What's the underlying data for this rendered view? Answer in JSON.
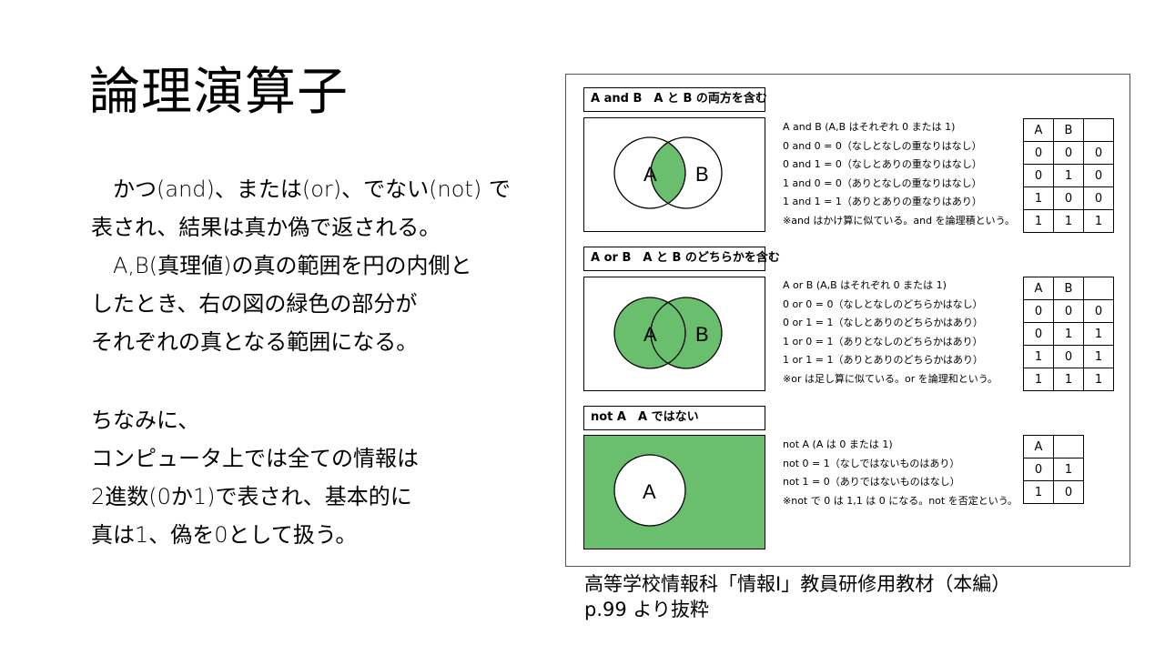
{
  "slide": {
    "title": "論理演算子",
    "paragraph1": [
      "　かつ(and)、または(or)、でない(not) で",
      "表され、結果は真か偽で返される。",
      "　A,B(真理値)の真の範囲を円の内側と",
      "したとき、右の図の緑色の部分が",
      "それぞれの真となる範囲になる。"
    ],
    "paragraph2": [
      "ちなみに、",
      "コンピュータ上では全ての情報は",
      "2進数(0か1)で表され、基本的に",
      "真は1、偽を0として扱う。"
    ],
    "caption": [
      "高等学校情報科「情報Ⅰ」教員研修用教材（本編）",
      "p.99 より抜粋"
    ]
  },
  "colors": {
    "green": "#6abf6e",
    "border": "#000000"
  },
  "figure": {
    "and": {
      "header": "A and B　A と B の両方を含む",
      "circle_a": "A",
      "circle_b": "B",
      "lines": [
        "A and B (A,B はそれぞれ 0 または 1)",
        "0 and 0 = 0（なしとなしの重なりはなし）",
        "0 and 1 = 0（なしとありの重なりはなし）",
        "1 and 0 = 0（ありとなしの重なりはなし）",
        "1 and 1 = 1（ありとありの重なりはあり）",
        "※and はかけ算に似ている。and を論理積という。"
      ],
      "table": [
        [
          "A",
          "B",
          ""
        ],
        [
          "0",
          "0",
          "0"
        ],
        [
          "0",
          "1",
          "0"
        ],
        [
          "1",
          "0",
          "0"
        ],
        [
          "1",
          "1",
          "1"
        ]
      ]
    },
    "or": {
      "header": "A or B　A と B のどちらかを含む",
      "circle_a": "A",
      "circle_b": "B",
      "lines": [
        "A or B (A,B はそれぞれ 0 または 1)",
        "0 or 0 = 0（なしとなしのどちらかはなし）",
        "0 or 1 = 1（なしとありのどちらかはあり）",
        "1 or 0 = 1（ありとなしのどちらかはあり）",
        "1 or 1 = 1（ありとありのどちらかはあり）",
        "※or は足し算に似ている。or を論理和という。"
      ],
      "table": [
        [
          "A",
          "B",
          ""
        ],
        [
          "0",
          "0",
          "0"
        ],
        [
          "0",
          "1",
          "1"
        ],
        [
          "1",
          "0",
          "1"
        ],
        [
          "1",
          "1",
          "1"
        ]
      ]
    },
    "not": {
      "header": "not A　A ではない",
      "circle_a": "A",
      "lines": [
        "not A (A は 0 または 1)",
        "not 0 = 1（なしではないものはあり）",
        "not 1 = 0（ありではないものはなし）",
        "※not で 0 は 1,1 は 0 になる。not を否定という。"
      ],
      "table": [
        [
          "A",
          ""
        ],
        [
          "0",
          "1"
        ],
        [
          "1",
          "0"
        ]
      ]
    }
  }
}
